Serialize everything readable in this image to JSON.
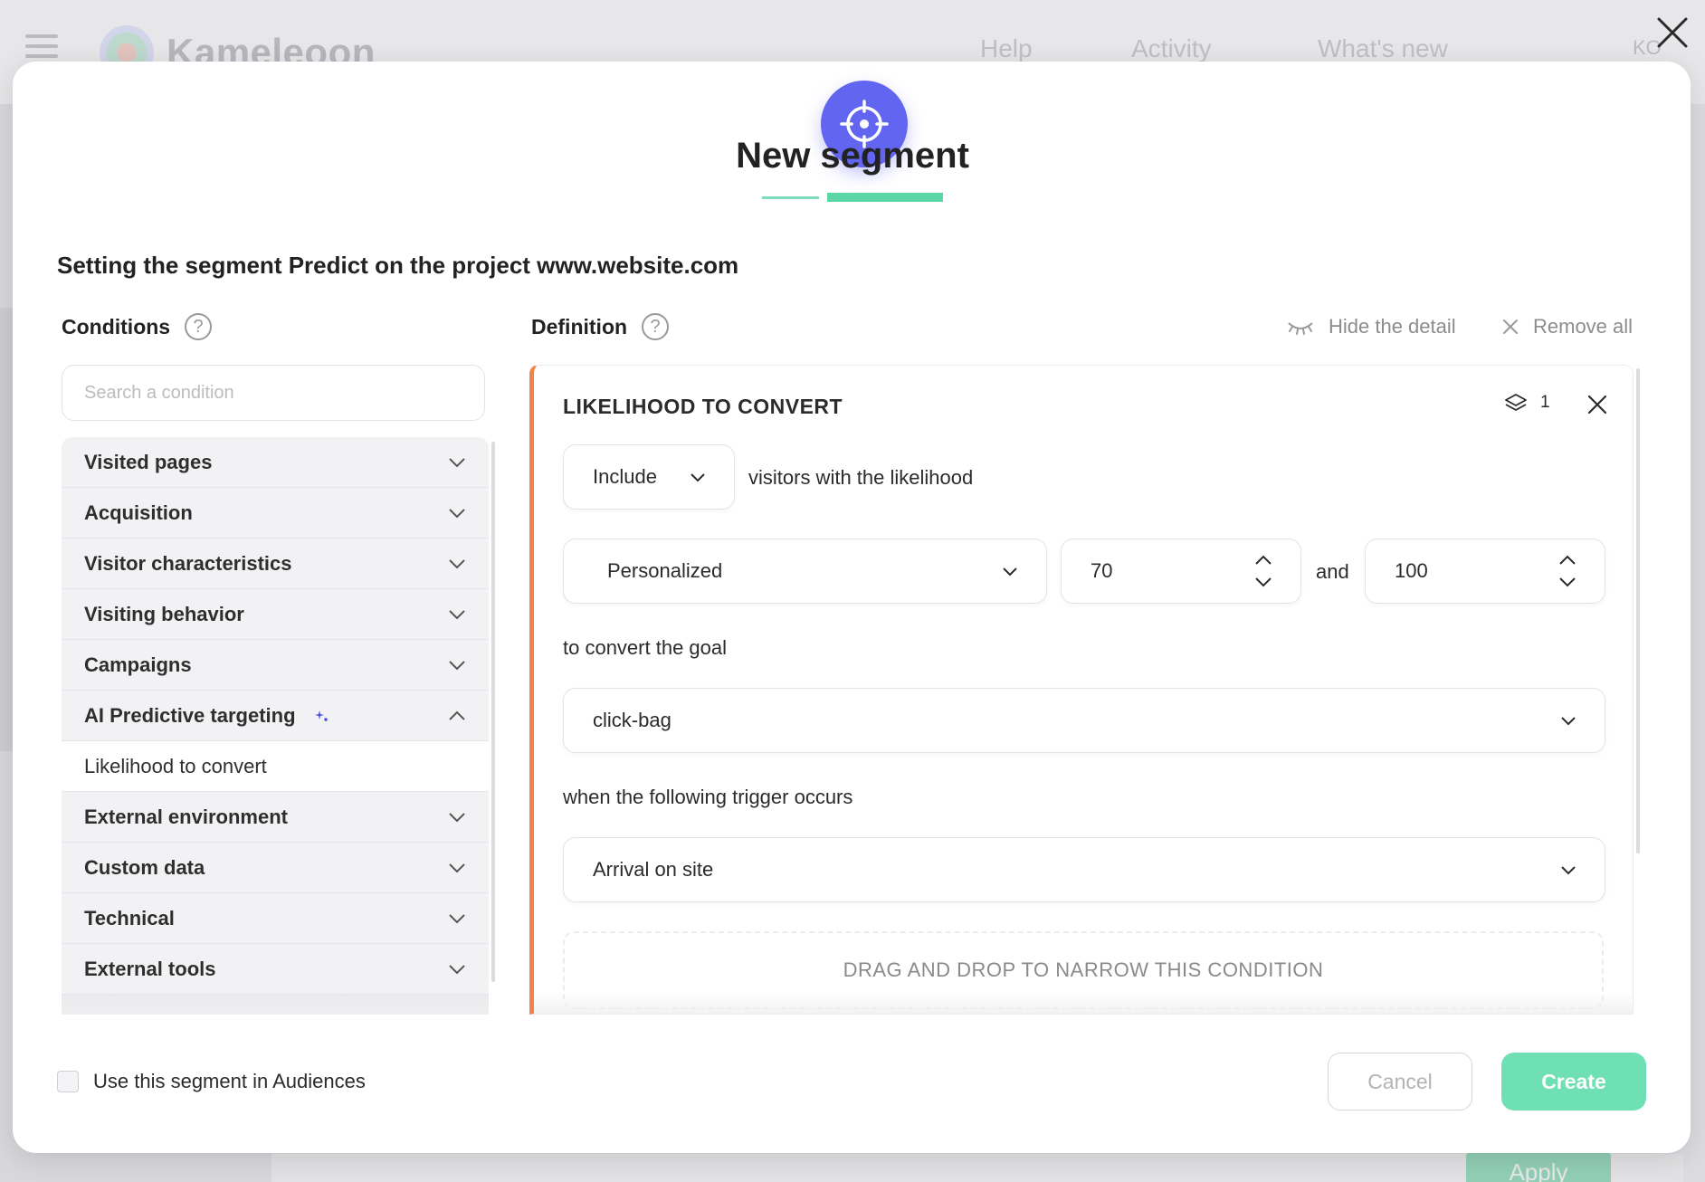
{
  "background": {
    "logo_text": "Kameleoon",
    "nav": [
      "Help",
      "Activity",
      "What's new"
    ],
    "user_initials": "KO",
    "apply_label": "Apply"
  },
  "modal": {
    "title": "New segment",
    "subtitle": "Setting the segment Predict on the project www.website.com",
    "conditions_label": "Conditions",
    "definition_label": "Definition",
    "help_glyph": "?",
    "hide_detail_label": "Hide the detail",
    "remove_all_label": "Remove all",
    "search_placeholder": "Search a condition",
    "condition_groups": [
      {
        "label": "Visited pages",
        "expanded": false
      },
      {
        "label": "Acquisition",
        "expanded": false
      },
      {
        "label": "Visitor characteristics",
        "expanded": false
      },
      {
        "label": "Visiting behavior",
        "expanded": false
      },
      {
        "label": "Campaigns",
        "expanded": false
      },
      {
        "label": "AI Predictive targeting",
        "expanded": true,
        "sub_items": [
          "Likelihood to convert"
        ]
      },
      {
        "label": "External environment",
        "expanded": false
      },
      {
        "label": "Custom data",
        "expanded": false
      },
      {
        "label": "Technical",
        "expanded": false
      },
      {
        "label": "External tools",
        "expanded": false
      }
    ],
    "card": {
      "title": "LIKELIHOOD TO CONVERT",
      "layer_count": "1",
      "include_value": "Include",
      "likelihood_text": "visitors with the likelihood",
      "mode_value": "Personalized",
      "min_value": "70",
      "and_text": "and",
      "max_value": "100",
      "goal_text": "to convert the goal",
      "goal_value": "click-bag",
      "trigger_text": "when the following trigger occurs",
      "trigger_value": "Arrival on site",
      "dropzone_text": "DRAG AND DROP TO NARROW THIS CONDITION"
    },
    "use_in_audiences_label": "Use this segment in Audiences",
    "cancel_label": "Cancel",
    "create_label": "Create"
  },
  "colors": {
    "accent_purple": "#6265f0",
    "accent_green": "#6fe0b3",
    "card_border_orange": "#f2844a"
  },
  "icons": [
    "hamburger-icon",
    "close-icon",
    "target-icon",
    "help-icon",
    "eye-closed-icon",
    "layers-icon",
    "chevron-down-icon",
    "chevron-up-icon",
    "sparkle-icon",
    "stepper-icon"
  ]
}
